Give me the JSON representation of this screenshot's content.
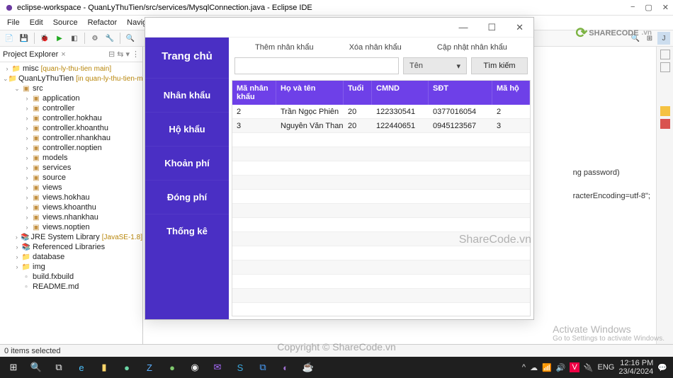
{
  "eclipse": {
    "title": "eclipse-workspace - QuanLyThuTien/src/services/MysqlConnection.java - Eclipse IDE",
    "menu": [
      "File",
      "Edit",
      "Source",
      "Refactor",
      "Navigate"
    ],
    "explorer": {
      "title": "Project Explorer",
      "tree": [
        {
          "d": 0,
          "a": ">",
          "i": "folder",
          "t": "misc",
          "s": "[quan-ly-thu-tien main]"
        },
        {
          "d": 0,
          "a": "v",
          "i": "folder",
          "t": "QuanLyThuTien",
          "s": "[in quan-ly-thu-tien-master]"
        },
        {
          "d": 1,
          "a": "v",
          "i": "pkg",
          "t": "src"
        },
        {
          "d": 2,
          "a": ">",
          "i": "pkg",
          "t": "application"
        },
        {
          "d": 2,
          "a": ">",
          "i": "pkg",
          "t": "controller"
        },
        {
          "d": 2,
          "a": ">",
          "i": "pkg",
          "t": "controller.hokhau"
        },
        {
          "d": 2,
          "a": ">",
          "i": "pkg",
          "t": "controller.khoanthu"
        },
        {
          "d": 2,
          "a": ">",
          "i": "pkg",
          "t": "controller.nhankhau"
        },
        {
          "d": 2,
          "a": ">",
          "i": "pkg",
          "t": "controller.noptien"
        },
        {
          "d": 2,
          "a": ">",
          "i": "pkg",
          "t": "models"
        },
        {
          "d": 2,
          "a": ">",
          "i": "pkg",
          "t": "services"
        },
        {
          "d": 2,
          "a": ">",
          "i": "pkg",
          "t": "source"
        },
        {
          "d": 2,
          "a": ">",
          "i": "pkg",
          "t": "views"
        },
        {
          "d": 2,
          "a": ">",
          "i": "pkg",
          "t": "views.hokhau"
        },
        {
          "d": 2,
          "a": ">",
          "i": "pkg",
          "t": "views.khoanthu"
        },
        {
          "d": 2,
          "a": ">",
          "i": "pkg",
          "t": "views.nhankhau"
        },
        {
          "d": 2,
          "a": ">",
          "i": "pkg",
          "t": "views.noptien"
        },
        {
          "d": 1,
          "a": ">",
          "i": "jar",
          "t": "JRE System Library",
          "s": "[JavaSE-1.8]"
        },
        {
          "d": 1,
          "a": ">",
          "i": "jar",
          "t": "Referenced Libraries"
        },
        {
          "d": 1,
          "a": ">",
          "i": "folder",
          "t": "database"
        },
        {
          "d": 1,
          "a": ">",
          "i": "folder",
          "t": "img"
        },
        {
          "d": 1,
          "a": "",
          "i": "file",
          "t": "build.fxbuild"
        },
        {
          "d": 1,
          "a": "",
          "i": "file",
          "t": "README.md"
        }
      ]
    },
    "status": "0 items selected",
    "code": {
      "l1": "ng password)",
      "l2": "racterEncoding=utf-8\";"
    }
  },
  "app": {
    "side_title": "Trang chủ",
    "sidenav": [
      "Nhân khẩu",
      "Hộ khẩu",
      "Khoản phí",
      "Đóng phí",
      "Thống kê"
    ],
    "actions": {
      "add": "Thêm nhân khẩu",
      "del": "Xóa nhân khẩu",
      "upd": "Cập nhật nhân khẩu"
    },
    "combo": "Tên",
    "search_btn": "Tìm kiếm",
    "search_ph": "",
    "headers": [
      "Mã nhân khẩu",
      "Họ và tên",
      "Tuổi",
      "CMND",
      "SĐT",
      "Mã hộ"
    ],
    "rows": [
      {
        "id": "2",
        "name": "Trần Ngọc Phiên",
        "age": "20",
        "cmnd": "122330541",
        "sdt": "0377016054",
        "maho": "2"
      },
      {
        "id": "3",
        "name": "Nguyễn Văn Thanh",
        "age": "20",
        "cmnd": "122440651",
        "sdt": "0945123567",
        "maho": "3"
      }
    ]
  },
  "watermark": {
    "logo": "SHARECODE",
    "sub": ".vn",
    "center": "Copyright © ShareCode.vn",
    "side": "ShareCode.vn"
  },
  "windows": {
    "activate_h": "Activate Windows",
    "activate_s": "Go to Settings to activate Windows.",
    "time": "12:16 PM",
    "date": "23/4/2024",
    "lang": "ENG"
  }
}
